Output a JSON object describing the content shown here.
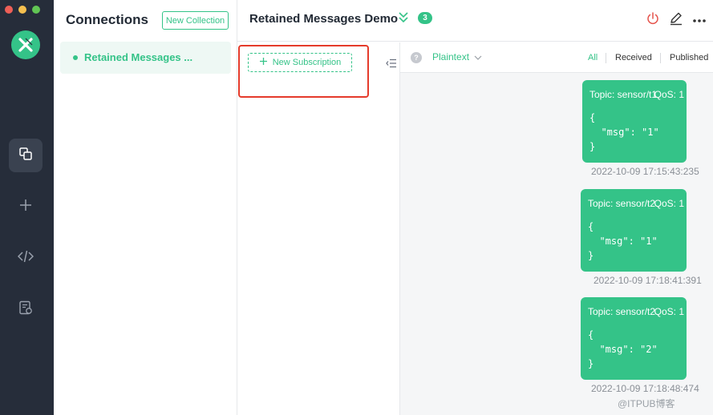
{
  "sidebar": {
    "icons": [
      "logo-icon",
      "connections-icon",
      "plus-icon",
      "script-icon",
      "log-icon"
    ]
  },
  "connections": {
    "title": "Connections",
    "new_collection_label": "New Collection",
    "items": [
      {
        "name": "Retained Messages ...",
        "status": "connected"
      }
    ]
  },
  "header": {
    "title": "Retained Messages Demo",
    "badge_count": "3"
  },
  "subscriptions": {
    "new_subscription_label": "New Subscription"
  },
  "messages": {
    "format": "Plaintext",
    "filters": {
      "all": "All",
      "received": "Received",
      "published": "Published"
    },
    "items": [
      {
        "topic": "Topic: sensor/t1",
        "qos": "QoS: 1",
        "lines": [
          "{",
          "  \"msg\": \"1\"",
          "}"
        ],
        "time": "2022-10-09 17:15:43:235"
      },
      {
        "topic": "Topic: sensor/t2",
        "qos": "QoS: 1",
        "lines": [
          "{",
          "  \"msg\": \"1\"",
          "}"
        ],
        "time": "2022-10-09 17:18:41:391"
      },
      {
        "topic": "Topic: sensor/t2",
        "qos": "QoS: 1",
        "lines": [
          "{",
          "  \"msg\": \"2\"",
          "}"
        ],
        "time": "2022-10-09 17:18:48:474"
      }
    ]
  },
  "watermark": "@ITPUB博客",
  "colors": {
    "accent": "#34c388",
    "sidebar_bg": "#262d3a",
    "highlight": "#e53b2b",
    "disconnect": "#e5534b"
  }
}
